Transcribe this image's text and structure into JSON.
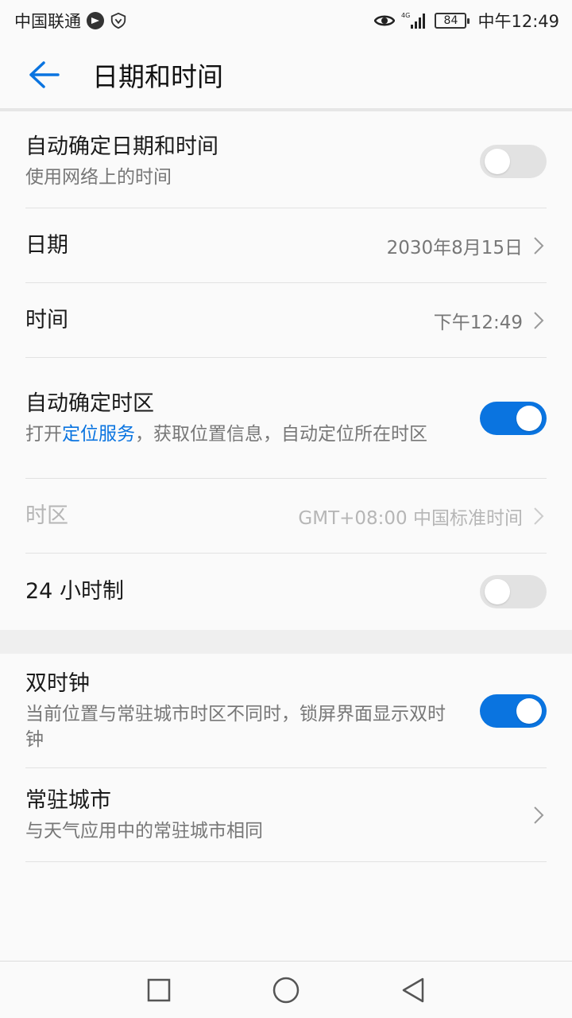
{
  "status_bar": {
    "carrier": "中国联通",
    "network": "4G",
    "battery": "84",
    "time": "中午12:49"
  },
  "header": {
    "title": "日期和时间"
  },
  "settings": {
    "auto_datetime": {
      "title": "自动确定日期和时间",
      "subtitle": "使用网络上的时间",
      "enabled": false
    },
    "date": {
      "title": "日期",
      "value": "2030年8月15日"
    },
    "time": {
      "title": "时间",
      "value": "下午12:49"
    },
    "auto_timezone": {
      "title": "自动确定时区",
      "subtitle_prefix": "打开",
      "subtitle_link": "定位服务",
      "subtitle_suffix": "，获取位置信息，自动定位所在时区",
      "enabled": true
    },
    "timezone": {
      "title": "时区",
      "value": "GMT+08:00 中国标准时间"
    },
    "hour24": {
      "title": "24 小时制",
      "enabled": false
    },
    "dual_clock": {
      "title": "双时钟",
      "subtitle": "当前位置与常驻城市时区不同时，锁屏界面显示双时钟",
      "enabled": true
    },
    "home_city": {
      "title": "常驻城市",
      "subtitle": "与天气应用中的常驻城市相同"
    }
  },
  "colors": {
    "accent": "#0a74e0",
    "toggle_off": "#e2e2e2"
  }
}
